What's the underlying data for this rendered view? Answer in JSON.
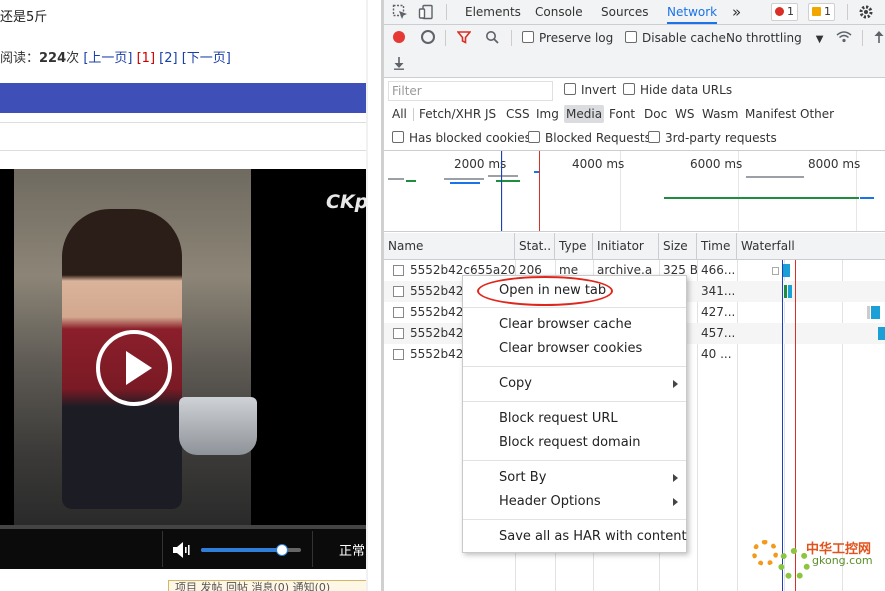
{
  "webpage": {
    "top_text": "还是5斤",
    "pager": {
      "prefix": "阅读：",
      "count": "224",
      "unit": "次",
      "prev": "[上一页]",
      "page1": "[1]",
      "page2": "[2]",
      "next": "[下一页]"
    },
    "video": {
      "watermark": "CKp",
      "speed_label": "正常",
      "volume_level": 0.8
    },
    "bottom_tabs": "项目  发帖  回帖  消息(0)  通知(0)"
  },
  "devtools": {
    "tabs": [
      "Elements",
      "Console",
      "Sources",
      "Network"
    ],
    "active_tab": "Network",
    "more_tabs": "»",
    "error_count": "1",
    "warning_count": "1",
    "toolbar": {
      "preserve_log": "Preserve log",
      "disable_cache": "Disable cache",
      "throttling": "No throttling"
    },
    "filter": {
      "placeholder": "Filter",
      "invert": "Invert",
      "hide_data_urls": "Hide data URLs",
      "types": [
        "All",
        "Fetch/XHR",
        "JS",
        "CSS",
        "Img",
        "Media",
        "Font",
        "Doc",
        "WS",
        "Wasm",
        "Manifest",
        "Other"
      ],
      "active_type": "Media",
      "has_blocked_cookies": "Has blocked cookies",
      "blocked_requests": "Blocked Requests",
      "third_party": "3rd-party requests"
    },
    "timeline": {
      "ticks": [
        "2000 ms",
        "4000 ms",
        "6000 ms",
        "8000 ms"
      ]
    },
    "columns": [
      "Name",
      "Stat..",
      "Type",
      "Initiator",
      "Size",
      "Time",
      "Waterfall"
    ],
    "rows": [
      {
        "name": "5552b42c655a20",
        "status": "206",
        "type": "me",
        "initiator": "archive.a",
        "size": "325 B",
        "time": "466..."
      },
      {
        "name": "5552b42c",
        "status": "",
        "type": "",
        "initiator": "",
        "size": "",
        "time": "341..."
      },
      {
        "name": "5552b42c",
        "status": "",
        "type": "",
        "initiator": "",
        "size": "",
        "time": "427..."
      },
      {
        "name": "5552b42c",
        "status": "",
        "type": "",
        "initiator": "",
        "size": "",
        "time": "457..."
      },
      {
        "name": "5552b42c",
        "status": "",
        "type": "",
        "initiator": "",
        "size": "",
        "time": "40 ..."
      }
    ],
    "context_menu": {
      "open_new_tab": "Open in new tab",
      "clear_cache": "Clear browser cache",
      "clear_cookies": "Clear browser cookies",
      "copy": "Copy",
      "block_url": "Block request URL",
      "block_domain": "Block request domain",
      "sort_by": "Sort By",
      "header_options": "Header Options",
      "save_har": "Save all as HAR with content"
    }
  },
  "watermark_logo": {
    "brand": "中华工控网",
    "domain": "gkong.com"
  },
  "colors": {
    "accent": "#1a73e8",
    "record": "#e53935",
    "bluebar": "#3e4fb7",
    "highlight_circle": "#e0261c"
  }
}
